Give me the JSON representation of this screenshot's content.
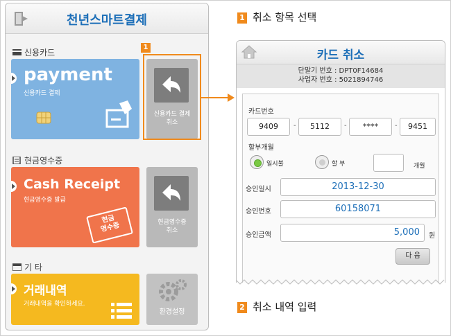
{
  "phone1": {
    "title": "천년스마트결제",
    "sections": {
      "credit_card": "신용카드",
      "cash_receipt": "현금영수증",
      "etc": "기 타"
    },
    "tiles": {
      "payment_big": "payment",
      "payment_small": "신용카드 결제",
      "card_cancel_line1": "신용카드 결제",
      "card_cancel_line2": "취소",
      "cash_big": "Cash Receipt",
      "cash_small": "현금영수증 발급",
      "cash_card_line1": "현금",
      "cash_card_line2": "영수증",
      "cash_cancel_line1": "현금영수증",
      "cash_cancel_line2": "취소",
      "history_big": "거래내역",
      "history_small": "거래내역을 확인하세요.",
      "settings": "환경설정"
    },
    "colors": {
      "payment": "#7fb3e1",
      "cash": "#f0744b",
      "history": "#f5b91f",
      "grey": "#b9b9b9"
    }
  },
  "callout": {
    "badge": "1"
  },
  "steps": {
    "step1_num": "1",
    "step1_label": "취소 항목 선택",
    "step2_num": "2",
    "step2_label": "취소 내역 입력"
  },
  "phone2": {
    "title": "카드 취소",
    "terminal_line": "단말기 번호 : DPT0F14684",
    "business_line": "사업자 번호 : 5021894746",
    "card_number_label": "카드번호",
    "card_number": [
      "9409",
      "5112",
      "****",
      "9451"
    ],
    "installment_label": "할부개월",
    "option_lump": "일시불",
    "option_install": "할 부",
    "months_unit": "개월",
    "approval_date_label": "승인일시",
    "approval_date": "2013-12-30",
    "approval_no_label": "승인번호",
    "approval_no": "60158071",
    "amount_label": "승인금액",
    "amount": "5,000",
    "currency": "원",
    "next_button": "다 음"
  }
}
